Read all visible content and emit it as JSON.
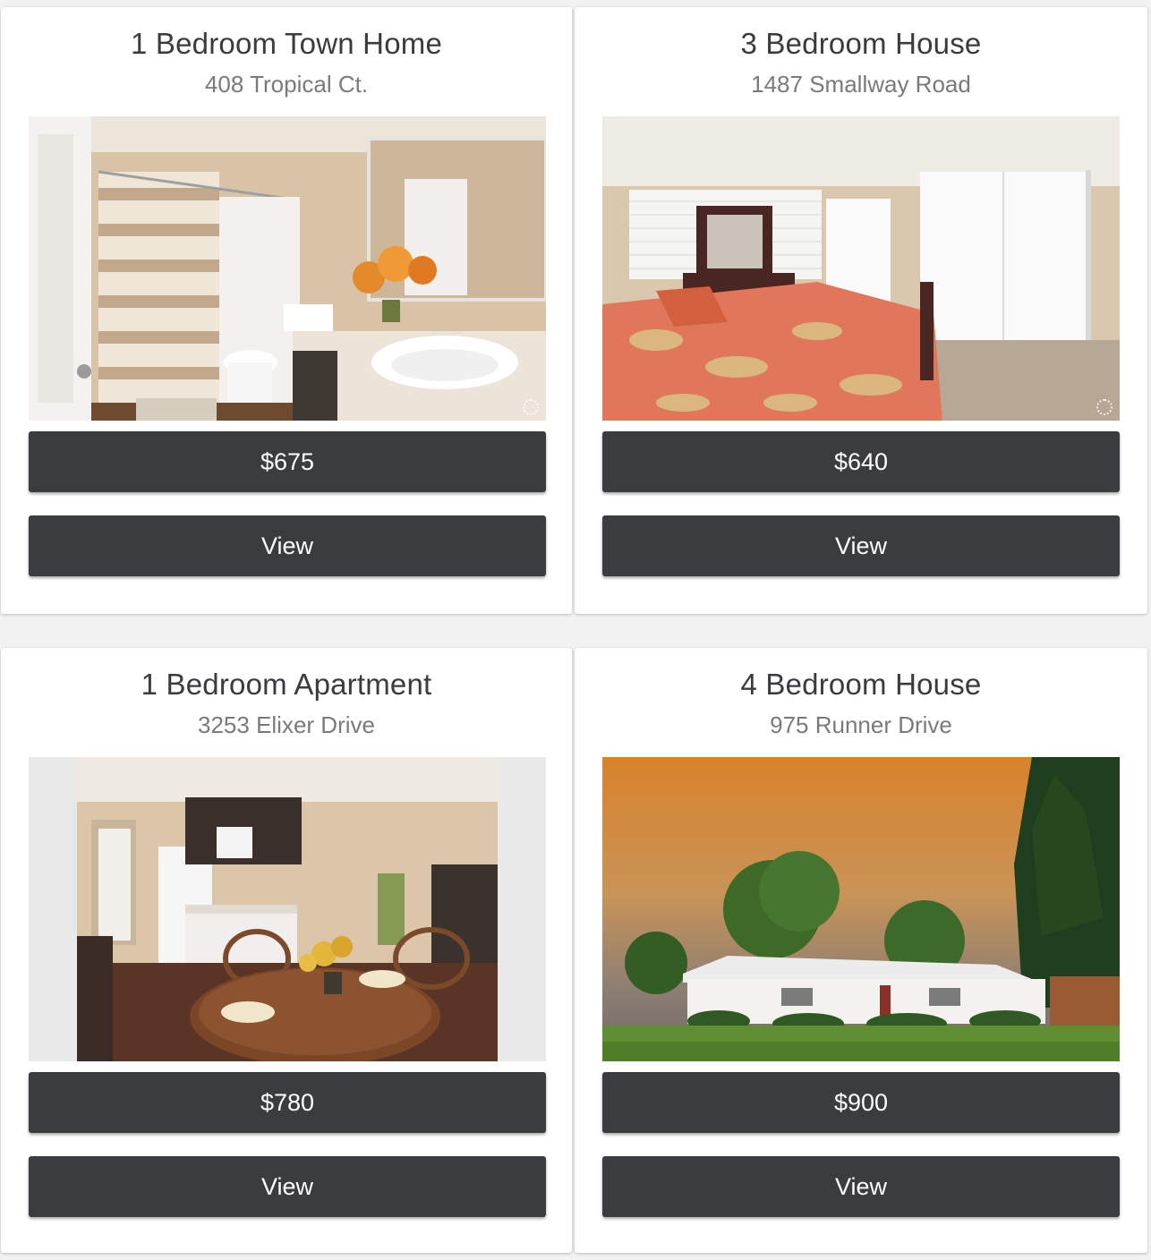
{
  "listings": [
    {
      "title": "1 Bedroom Town Home",
      "address": "408 Tropical Ct.",
      "price": "$675",
      "view_label": "View",
      "photo": "bathroom-photo"
    },
    {
      "title": "3 Bedroom House",
      "address": "1487 Smallway Road",
      "price": "$640",
      "view_label": "View",
      "photo": "bedroom-photo"
    },
    {
      "title": "1 Bedroom Apartment",
      "address": "3253 Elixer Drive",
      "price": "$780",
      "view_label": "View",
      "photo": "kitchen-dining-photo"
    },
    {
      "title": "4 Bedroom House",
      "address": "975 Runner Drive",
      "price": "$900",
      "view_label": "View",
      "photo": "house-exterior-photo"
    }
  ],
  "colors": {
    "background": "#f1f2f1",
    "card": "#ffffff",
    "button": "#3a3c40",
    "title_text": "#3a3b3f",
    "address_text": "#7a7a7a"
  }
}
